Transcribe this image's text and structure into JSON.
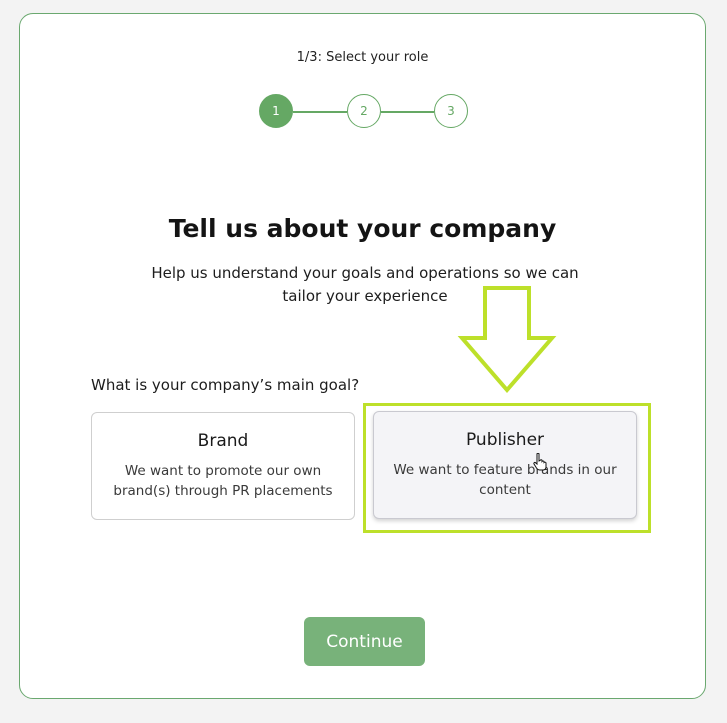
{
  "step_label": "1/3: Select your role",
  "steps": [
    "1",
    "2",
    "3"
  ],
  "title": "Tell us about your company",
  "subtitle": "Help us understand your goals and operations so we can tailor your experience",
  "question": "What is your company’s main goal?",
  "options": [
    {
      "title": "Brand",
      "description": "We want to promote our own brand(s) through PR placements"
    },
    {
      "title": "Publisher",
      "description": "We want to feature brands in our content"
    }
  ],
  "continue_label": "Continue",
  "colors": {
    "accent": "#65a864",
    "border": "#6aa86f",
    "highlight": "#bde02a",
    "button": "#78b27a"
  },
  "icons": [
    "down-arrow-annotation-icon",
    "hand-cursor-icon"
  ]
}
